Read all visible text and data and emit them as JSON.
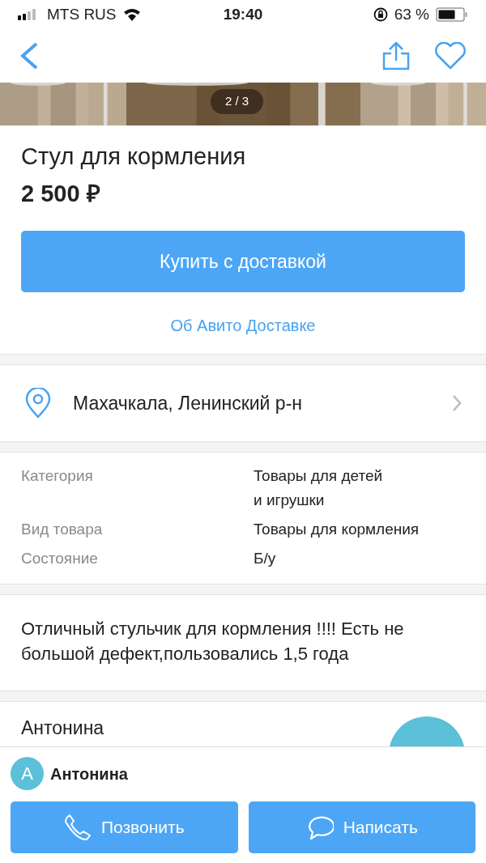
{
  "status_bar": {
    "carrier": "MTS RUS",
    "time": "19:40",
    "battery": "63 %"
  },
  "gallery": {
    "counter": "2 / 3"
  },
  "listing": {
    "title": "Стул для кормления",
    "price": "2 500 ₽",
    "buy_button": "Купить с доставкой",
    "delivery_link": "Об Авито Доставке"
  },
  "location": "Махачкала, Ленинский р-н",
  "properties": [
    {
      "label": "Категория",
      "value": "Товары для детей\nи игрушки"
    },
    {
      "label": "Вид товара",
      "value": "Товары для кормления"
    },
    {
      "label": "Состояние",
      "value": "Б/у"
    }
  ],
  "description": "Отличный стульчик для кормления !!!! Есть не большой дефект,пользовались 1,5 года",
  "seller": {
    "name": "Антонина"
  },
  "bottom_bar": {
    "avatar_letter": "А",
    "name": "Антонина",
    "call_button": "Позвонить",
    "message_button": "Написать"
  }
}
